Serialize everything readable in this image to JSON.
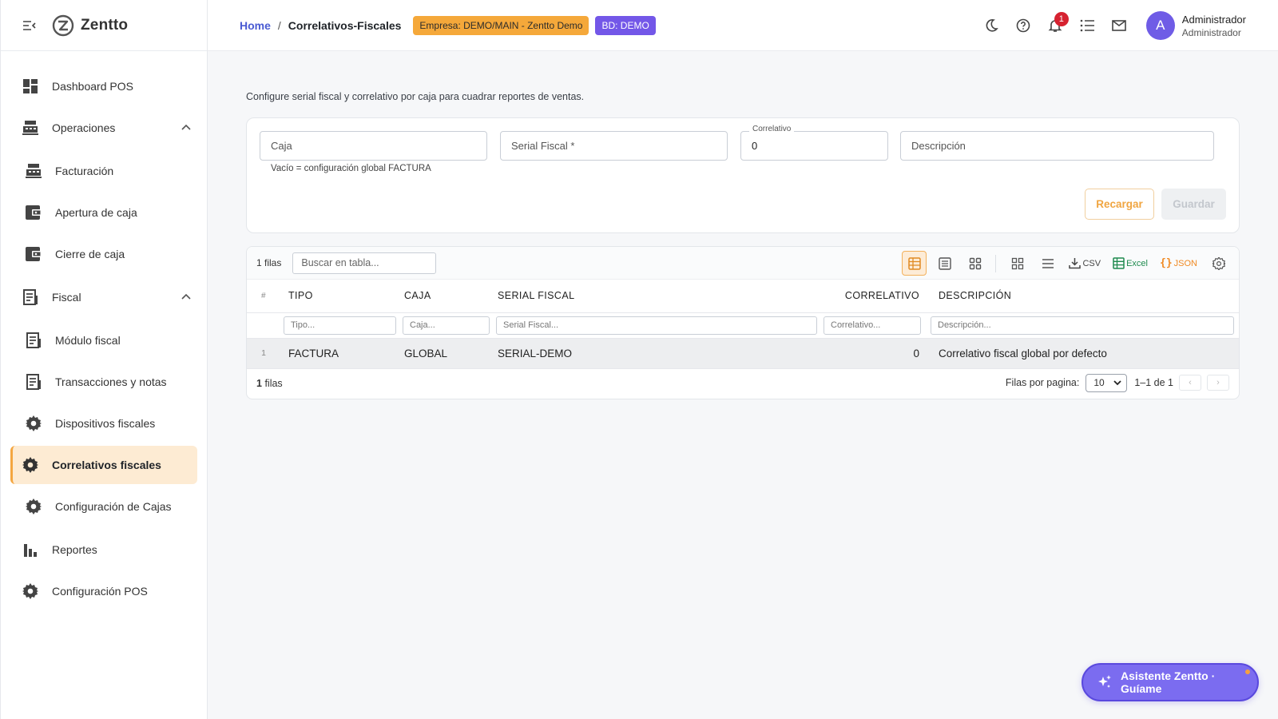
{
  "app": {
    "name": "Zentto"
  },
  "sidebar": {
    "items": [
      {
        "label": "Dashboard POS",
        "icon": "dashboard-icon"
      },
      {
        "label": "Operaciones",
        "icon": "register-icon",
        "expanded": true
      },
      {
        "label": "Facturación",
        "icon": "register-icon"
      },
      {
        "label": "Apertura de caja",
        "icon": "wallet-icon"
      },
      {
        "label": "Cierre de caja",
        "icon": "wallet-icon"
      },
      {
        "label": "Fiscal",
        "icon": "receipt-icon",
        "expanded": true
      },
      {
        "label": "Módulo fiscal",
        "icon": "receipt-icon"
      },
      {
        "label": "Transacciones y notas",
        "icon": "receipt-icon"
      },
      {
        "label": "Dispositivos fiscales",
        "icon": "gear-icon"
      },
      {
        "label": "Correlativos fiscales",
        "icon": "gear-icon",
        "active": true
      },
      {
        "label": "Configuración de Cajas",
        "icon": "gear-icon"
      },
      {
        "label": "Reportes",
        "icon": "bar-chart-icon"
      },
      {
        "label": "Configuración POS",
        "icon": "gear-icon"
      }
    ]
  },
  "header": {
    "breadcrumb": {
      "home": "Home",
      "separator": "/",
      "current": "Correlativos-Fiscales"
    },
    "company_chip": "Empresa: DEMO/MAIN - Zentto Demo",
    "db_chip": "BD: DEMO",
    "notifications_count": "1",
    "user": {
      "initial": "A",
      "name": "Administrador",
      "role": "Administrador"
    }
  },
  "page": {
    "description": "Configure serial fiscal y correlativo por caja para cuadrar reportes de ventas."
  },
  "form": {
    "caja_placeholder": "Caja",
    "caja_helper": "Vacío = configuración global FACTURA",
    "serial_placeholder": "Serial Fiscal *",
    "correlativo_label": "Correlativo",
    "correlativo_value": "0",
    "descripcion_placeholder": "Descripción",
    "reload_label": "Recargar",
    "save_label": "Guardar"
  },
  "table": {
    "rows_label": "1 filas",
    "search_placeholder": "Buscar en tabla...",
    "export": {
      "csv": "CSV",
      "excel": "Excel",
      "json": "JSON"
    },
    "columns": {
      "idx": "#",
      "tipo": "TIPO",
      "caja": "CAJA",
      "serial": "SERIAL FISCAL",
      "correlativo": "CORRELATIVO",
      "descripcion": "DESCRIPCIÓN"
    },
    "filters": {
      "tipo": "Tipo...",
      "caja": "Caja...",
      "serial": "Serial Fiscal...",
      "correlativo": "Correlativo...",
      "descripcion": "Descripción..."
    },
    "rows": [
      {
        "idx": "1",
        "tipo": "FACTURA",
        "caja": "GLOBAL",
        "serial": "SERIAL-DEMO",
        "correlativo": "0",
        "descripcion": "Correlativo fiscal global por defecto"
      }
    ],
    "footer": {
      "count_number": "1",
      "count_text": "filas",
      "per_page_label": "Filas por pagina:",
      "per_page_value": "10",
      "range": "1–1 de 1"
    }
  },
  "assistant": {
    "label": "Asistente Zentto · Guíame"
  },
  "colors": {
    "accent": "#f4a640",
    "brand_purple": "#7357e8",
    "link": "#4a5bd3"
  }
}
